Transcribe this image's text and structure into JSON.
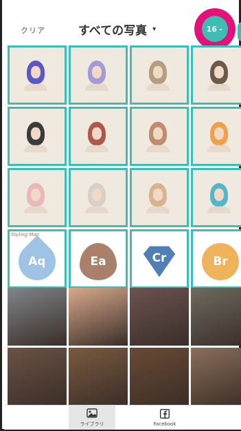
{
  "header": {
    "clear_label": "クリア",
    "album_title": "すべての写真",
    "caret": "▾",
    "selected_count": "16",
    "chevron": "⌄"
  },
  "grid": {
    "swatch_caption": "Styling Map",
    "swatches": [
      {
        "code": "Aq",
        "color": "#9fc3e4"
      },
      {
        "code": "Ea",
        "color": "#a98069"
      },
      {
        "code": "Cr",
        "color": "#4f7fb5"
      },
      {
        "code": "Br",
        "color": "#efb35c"
      }
    ],
    "portrait_hair_colors": [
      "#5a58c9",
      "#a49ad6",
      "#b59e80",
      "#6d5a4c",
      "#3b3b3b",
      "#b0584a",
      "#c08c6e",
      "#f0a04c",
      "#e9b8b8",
      "#d9d0c8",
      "#d7b48e",
      "#53b6c9"
    ]
  },
  "photos": {
    "colors": [
      "#7f858a",
      "#d9a98c",
      "#6c5250",
      "#6e6a60",
      "#6b5244",
      "#7a5a40",
      "#6a4a34",
      "#8a6f5a"
    ]
  },
  "tabbar": {
    "library_label": "ライブラリ",
    "facebook_label": "Facebook",
    "library_icon": "photo-icon",
    "facebook_icon": "facebook-icon"
  },
  "colors": {
    "accent": "#3dbdb3",
    "badge": "#e3127b"
  }
}
